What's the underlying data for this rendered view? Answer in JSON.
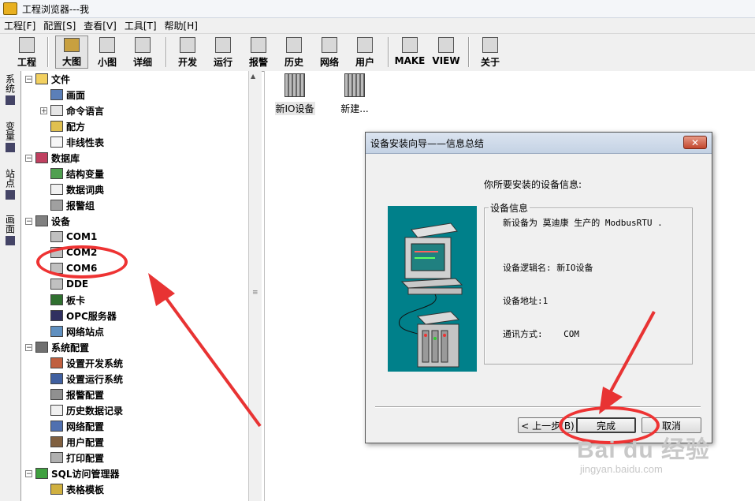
{
  "window": {
    "title": "工程浏览器---我"
  },
  "menu": [
    "工程[F]",
    "配置[S]",
    "查看[V]",
    "工具[T]",
    "帮助[H]"
  ],
  "toolbar": {
    "buttons": [
      "工程",
      "大图",
      "小图",
      "详细",
      "开发",
      "运行",
      "报警",
      "历史",
      "网络",
      "用户",
      "MAKE",
      "VIEW",
      "关于"
    ],
    "active": "大图"
  },
  "side_tabs": [
    "系统",
    "变量",
    "站点",
    "画面"
  ],
  "tree": {
    "file": {
      "label": "文件",
      "children": [
        "画面",
        "命令语言",
        "配方",
        "非线性表"
      ]
    },
    "database": {
      "label": "数据库",
      "children": [
        "结构变量",
        "数据词典",
        "报警组"
      ]
    },
    "device": {
      "label": "设备",
      "children": [
        "COM1",
        "COM2",
        "COM6",
        "DDE",
        "板卡",
        "OPC服务器",
        "网络站点"
      ]
    },
    "sysconfig": {
      "label": "系统配置",
      "children": [
        "设置开发系统",
        "设置运行系统",
        "报警配置",
        "历史数据记录",
        "网络配置",
        "用户配置",
        "打印配置"
      ]
    },
    "sql": {
      "label": "SQL访问管理器",
      "children": [
        "表格模板"
      ]
    }
  },
  "devices": [
    {
      "label": "新IO设备"
    },
    {
      "label": "新建..."
    }
  ],
  "dialog": {
    "title": "设备安装向导——信息总结",
    "close": "✕",
    "prompt": "你所要安装的设备信息:",
    "group": "设备信息",
    "line1": "新设备为 莫迪康 生产的 ModbusRTU .",
    "line2": "设备逻辑名: 新IO设备",
    "line3": "设备地址:1",
    "line4": "通讯方式:    COM",
    "back": "< 上一步(B)",
    "finish": "完成",
    "cancel": "取消"
  },
  "watermark": {
    "brand": "Bai du 经验",
    "url": "jingyan.baidu.com"
  },
  "colors": {
    "annotation": "#e83333",
    "picture_bg": "#00808a"
  }
}
